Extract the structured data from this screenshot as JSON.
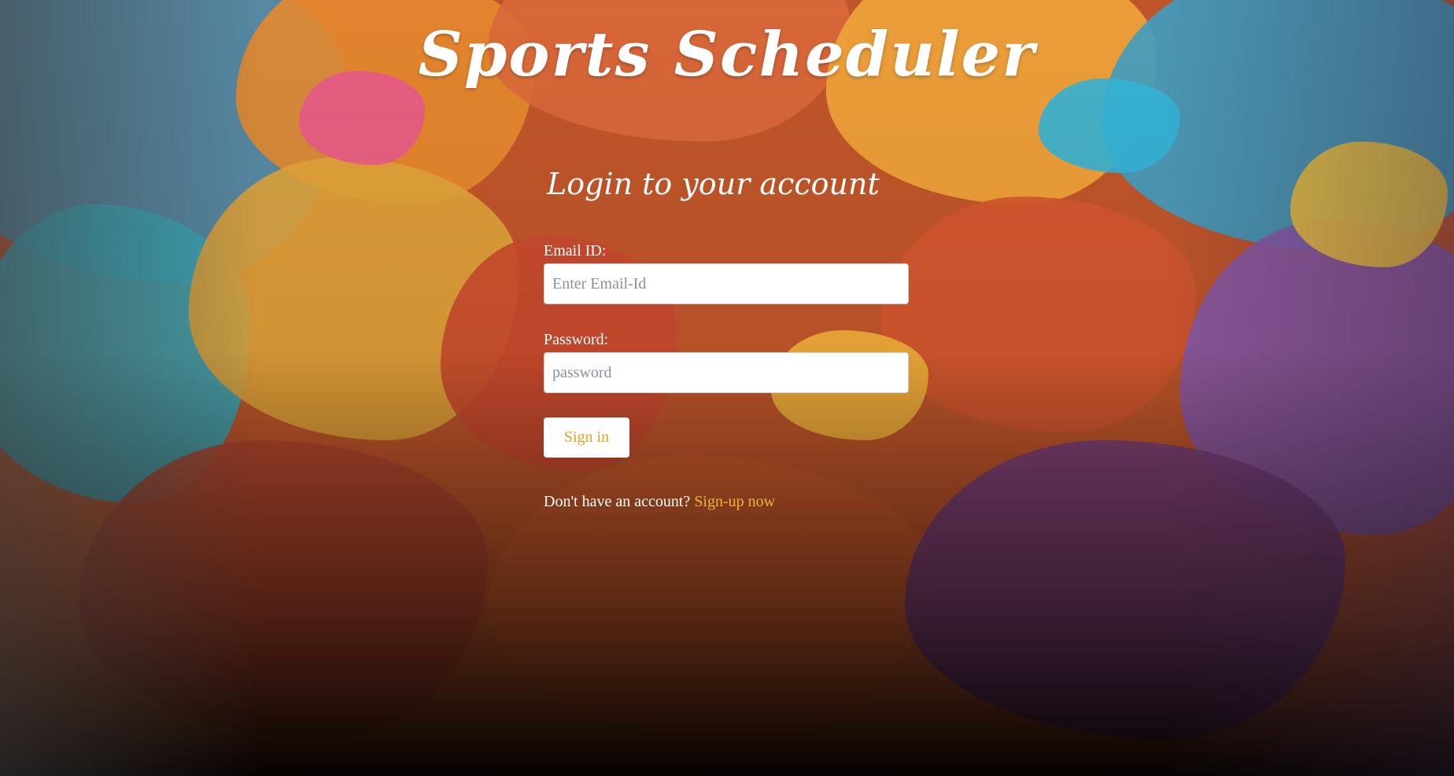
{
  "app": {
    "title": "Sports Scheduler"
  },
  "login_form": {
    "heading": "Login to your account",
    "email": {
      "label": "Email ID:",
      "placeholder": "Enter Email-Id",
      "value": ""
    },
    "password": {
      "label": "Password:",
      "placeholder": "password",
      "value": ""
    },
    "submit_label": "Sign in",
    "signup_prompt": "Don't have an account?",
    "signup_link": "Sign-up now"
  },
  "colors": {
    "accent": "#e3a32a",
    "link": "#f0b23a",
    "text": "#ffffff"
  }
}
